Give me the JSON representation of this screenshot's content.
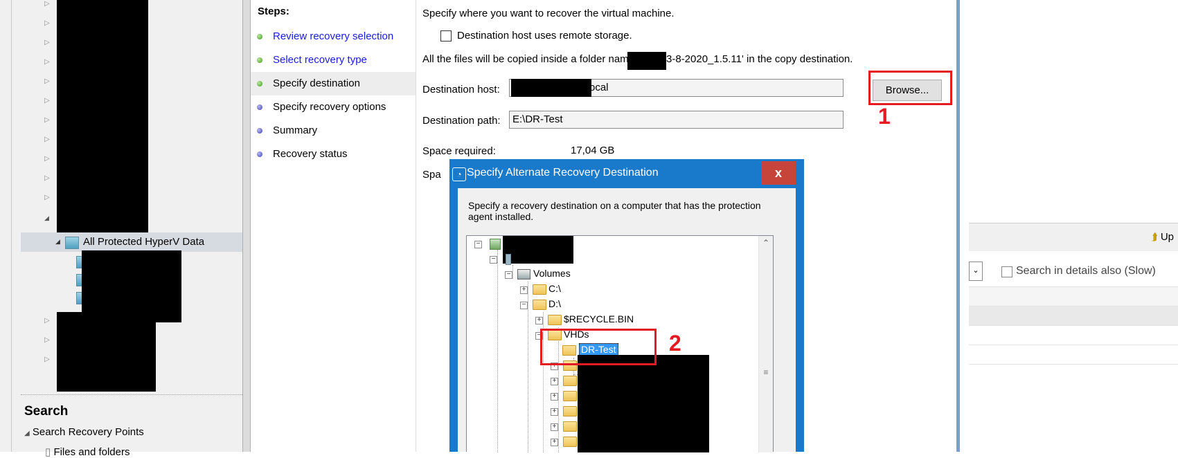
{
  "nav": {
    "selected_item": "All Protected HyperV Data",
    "search_title": "Search",
    "search_recovery_points": "Search Recovery Points",
    "files_and_folders": "Files and folders"
  },
  "wizard": {
    "steps_header": "Steps:",
    "steps": [
      {
        "label": "Review recovery selection",
        "state": "done"
      },
      {
        "label": "Select recovery type",
        "state": "done"
      },
      {
        "label": "Specify destination",
        "state": "current"
      },
      {
        "label": "Specify recovery options",
        "state": "todo"
      },
      {
        "label": "Summary",
        "state": "todo"
      },
      {
        "label": "Recovery status",
        "state": "todo"
      }
    ],
    "intro": "Specify where you want to recover the virtual machine.",
    "remote_storage_checkbox": "Destination host uses remote storage.",
    "copy_note_prefix": "All the files will be copied inside a folder named",
    "copy_note_suffix": "3-8-2020_1.5.11' in the copy destination.",
    "destination_host_label": "Destination host:",
    "destination_host_value": "ocal",
    "browse_button": "Browse...",
    "destination_path_label": "Destination path:",
    "destination_path_value": "E:\\DR-Test",
    "space_required_label": "Space required:",
    "space_required_value": "17,04 GB",
    "space_available_partial": "Spa"
  },
  "annotations": {
    "marker1": "1",
    "marker2": "2",
    "color": "#e51b24"
  },
  "dialog": {
    "title": "Specify Alternate Recovery Destination",
    "close_glyph": "x",
    "description": "Specify a recovery destination on a computer that has the protection agent installed.",
    "tree": {
      "volumes": "Volumes",
      "c_drive": "C:\\",
      "d_drive": "D:\\",
      "recycle_bin": "$RECYCLE.BIN",
      "vhds": "VHDs",
      "dr_test": "DR-Test"
    },
    "scroll_up_glyph": "⌃",
    "scroll_thumb_glyph": "≡"
  },
  "right_pane": {
    "up_button": "Up",
    "search_details_checkbox": "Search in details also (Slow)",
    "combo_arrow": "⌄"
  },
  "colors": {
    "dialog_frame": "#1979ca",
    "close_button": "#c7443a",
    "link_text": "#1a1ae6",
    "highlight": "#3399ff"
  }
}
